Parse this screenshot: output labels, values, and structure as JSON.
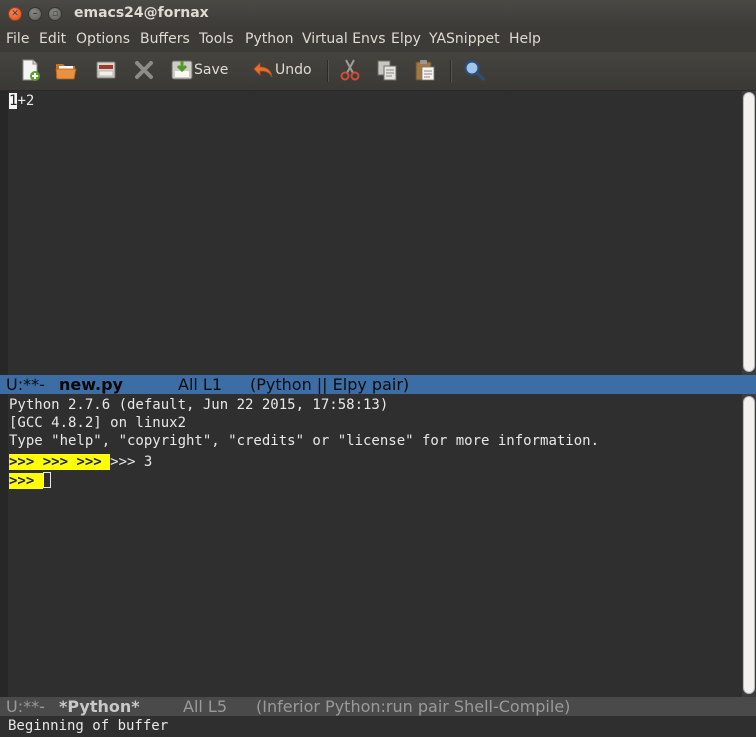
{
  "window": {
    "title": "emacs24@fornax"
  },
  "menubar": {
    "items": [
      "File",
      "Edit",
      "Options",
      "Buffers",
      "Tools",
      "Python",
      "Virtual Envs",
      "Elpy",
      "YASnippet",
      "Help"
    ]
  },
  "toolbar": {
    "save_label": "Save",
    "undo_label": "Undo",
    "icons": [
      "new-file-icon",
      "open-folder-icon",
      "dired-icon",
      "close-icon",
      "save-icon",
      "undo-icon",
      "cut-icon",
      "copy-icon",
      "paste-icon",
      "search-icon"
    ]
  },
  "editor": {
    "cursor_char": "1",
    "line_rest": "+2"
  },
  "modeline_top": {
    "status": "U:**-",
    "buffer_name": "new.py",
    "position": "All L1",
    "modes": "(Python || Elpy pair)"
  },
  "shell": {
    "lines": [
      "Python 2.7.6 (default, Jun 22 2015, 17:58:13)",
      "[GCC 4.8.2] on linux2",
      "Type \"help\", \"copyright\", \"credits\" or \"license\" for more information."
    ],
    "prompt_group": ">>> >>> >>> ",
    "output_after_prompts": ">>> 3",
    "current_prompt": ">>> "
  },
  "modeline_bottom": {
    "status": "U:**-",
    "buffer_name": "*Python*",
    "position": "All L5",
    "modes": "(Inferior Python:run pair Shell-Compile)"
  },
  "echo_area": {
    "message": "Beginning of buffer"
  },
  "colors": {
    "active_modeline": "#3c6ea5",
    "inactive_modeline": "#4a4a4a",
    "prompt_highlight": "#ffff00",
    "background": "#2f2f2f"
  }
}
